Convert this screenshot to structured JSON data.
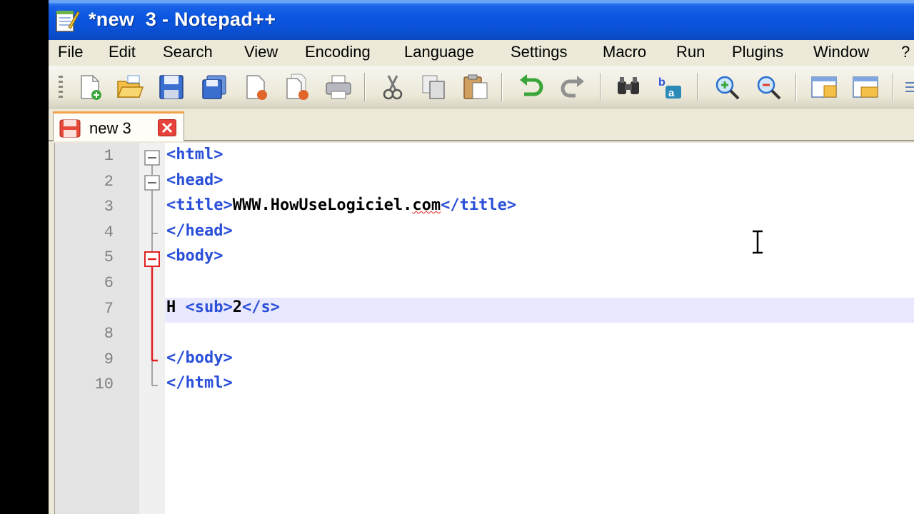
{
  "window": {
    "title": "*new  3 - Notepad++"
  },
  "menu": [
    "File",
    "Edit",
    "Search",
    "View",
    "Encoding",
    "Language",
    "Settings",
    "Macro",
    "Run",
    "Plugins",
    "Window",
    "?"
  ],
  "toolbar": {
    "icons": [
      "new-file-icon",
      "open-folder-icon",
      "save-icon",
      "save-all-icon",
      "close-file-icon",
      "close-all-icon",
      "print-icon",
      "cut-icon",
      "copy-icon",
      "paste-icon",
      "undo-icon",
      "redo-icon",
      "find-icon",
      "replace-icon",
      "zoom-in-icon",
      "zoom-out-icon",
      "sync-vertical-icon",
      "sync-horizontal-icon"
    ]
  },
  "tab": {
    "label": "new 3"
  },
  "editor": {
    "current_line": 7,
    "lines": [
      {
        "num": "1",
        "parts": [
          {
            "t": "<html>",
            "c": "tag"
          }
        ]
      },
      {
        "num": "2",
        "parts": [
          {
            "t": "<head>",
            "c": "tag"
          }
        ]
      },
      {
        "num": "3",
        "parts": [
          {
            "t": "<title>",
            "c": "tag"
          },
          {
            "t": "WWW.HowUseLogiciel.com",
            "c": "txt"
          },
          {
            "t": "</title>",
            "c": "tag"
          }
        ]
      },
      {
        "num": "4",
        "parts": [
          {
            "t": "</head>",
            "c": "tag"
          }
        ]
      },
      {
        "num": "5",
        "parts": [
          {
            "t": "<body>",
            "c": "tag"
          }
        ]
      },
      {
        "num": "6",
        "parts": []
      },
      {
        "num": "7",
        "parts": [
          {
            "t": "H ",
            "c": "txt"
          },
          {
            "t": "<sub>",
            "c": "tag"
          },
          {
            "t": "2",
            "c": "txt"
          },
          {
            "t": "</s>",
            "c": "tag"
          }
        ]
      },
      {
        "num": "8",
        "parts": []
      },
      {
        "num": "9",
        "parts": [
          {
            "t": "</body>",
            "c": "tag"
          }
        ]
      },
      {
        "num": "10",
        "parts": [
          {
            "t": "</html>",
            "c": "tag"
          }
        ]
      }
    ]
  },
  "colors": {
    "tag": "#2a4fd8",
    "text": "#000000",
    "title_bar": "#0a56e0",
    "fold_active": "#e02020"
  }
}
